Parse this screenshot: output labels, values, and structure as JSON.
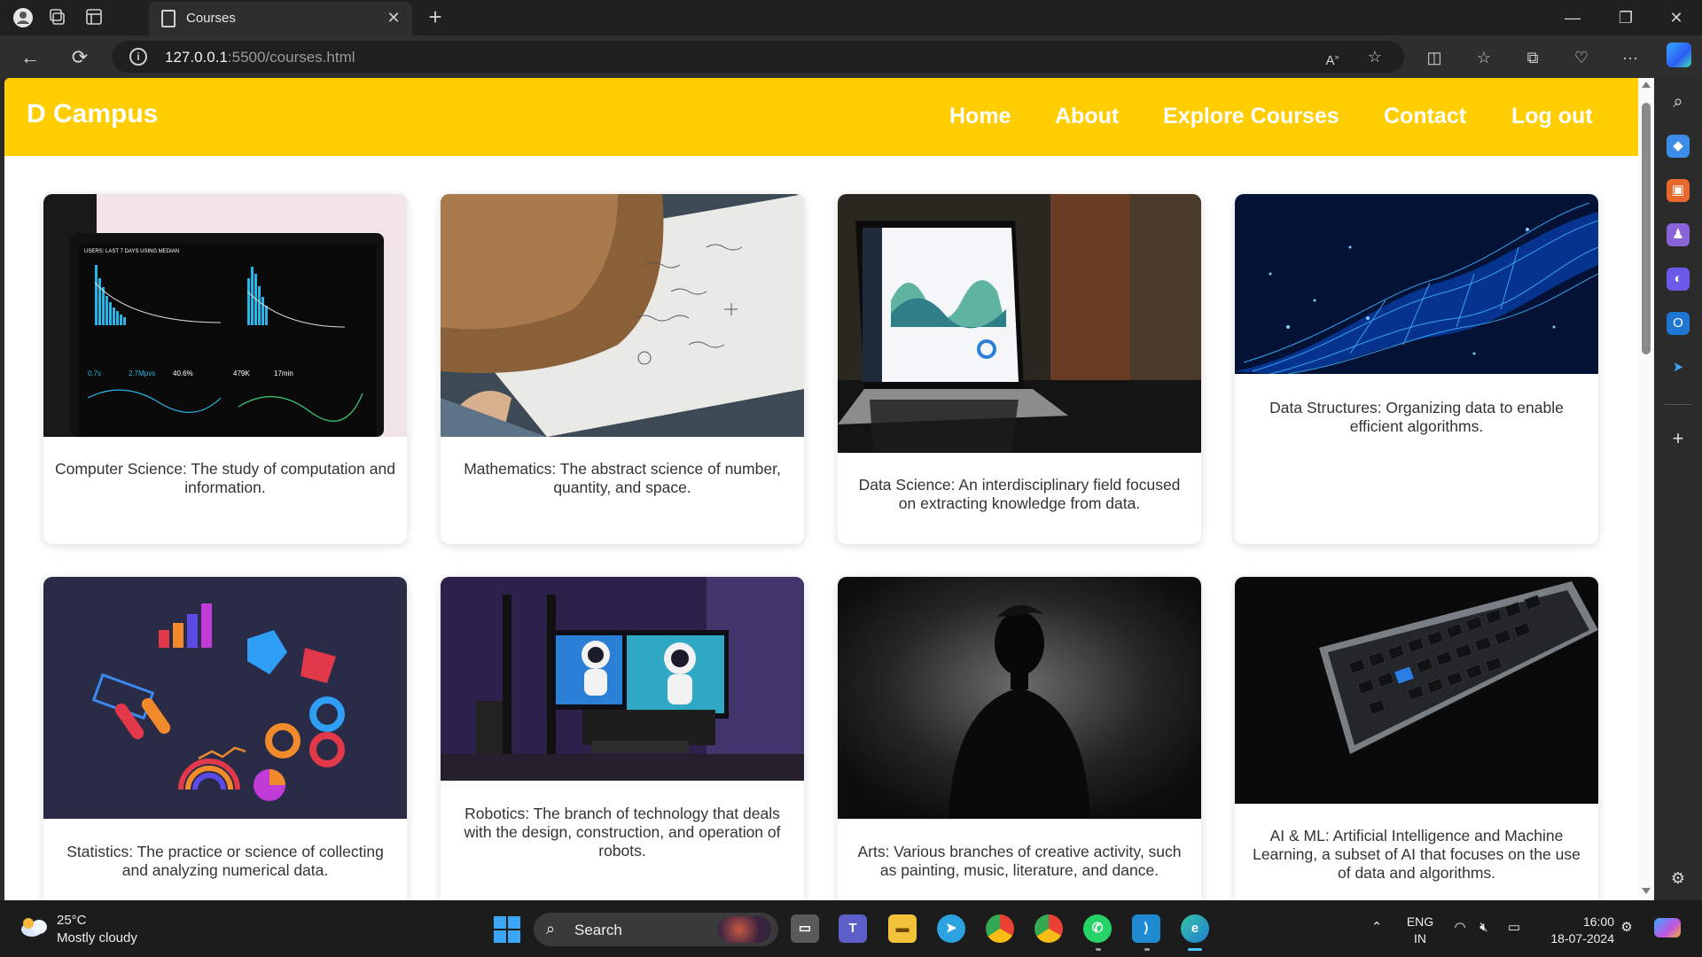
{
  "browser": {
    "tab_title": "Courses",
    "url_host": "127.0.0.1",
    "url_rest": ":5500/courses.html"
  },
  "site": {
    "brand": "D Campus",
    "nav": [
      "Home",
      "About",
      "Explore Courses",
      "Contact",
      "Log out"
    ]
  },
  "courses": [
    {
      "text": "Computer Science: The study of computation and information.",
      "image": "analytics-dashboard-laptop"
    },
    {
      "text": "Mathematics: The abstract science of number, quantity, and space.",
      "image": "person-writing-equations"
    },
    {
      "text": "Data Science: An interdisciplinary field focused on extracting knowledge from data.",
      "image": "laptop-with-charts"
    },
    {
      "text": "Data Structures: Organizing data to enable efficient algorithms.",
      "image": "blue-data-network"
    },
    {
      "text": "Statistics: The practice or science of collecting and analyzing numerical data.",
      "image": "data-analytics-3d-icons"
    },
    {
      "text": "Robotics: The branch of technology that deals with the design, construction, and operation of robots.",
      "image": "robot-figures-desk"
    },
    {
      "text": "Arts: Various branches of creative activity, such as painting, music, literature, and dance.",
      "image": "person-silhouette"
    },
    {
      "text": "AI & ML: Artificial Intelligence and Machine Learning, a subset of AI that focuses on the use of data and algorithms.",
      "image": "keyboard-ai-key"
    }
  ],
  "taskbar": {
    "temperature": "25°C",
    "weather": "Mostly cloudy",
    "search_label": "Search",
    "lang_top": "ENG",
    "lang_bottom": "IN",
    "time": "16:00",
    "date": "18-07-2024"
  },
  "colors": {
    "header": "#ffcd00",
    "page_bg": "#ffffff"
  }
}
